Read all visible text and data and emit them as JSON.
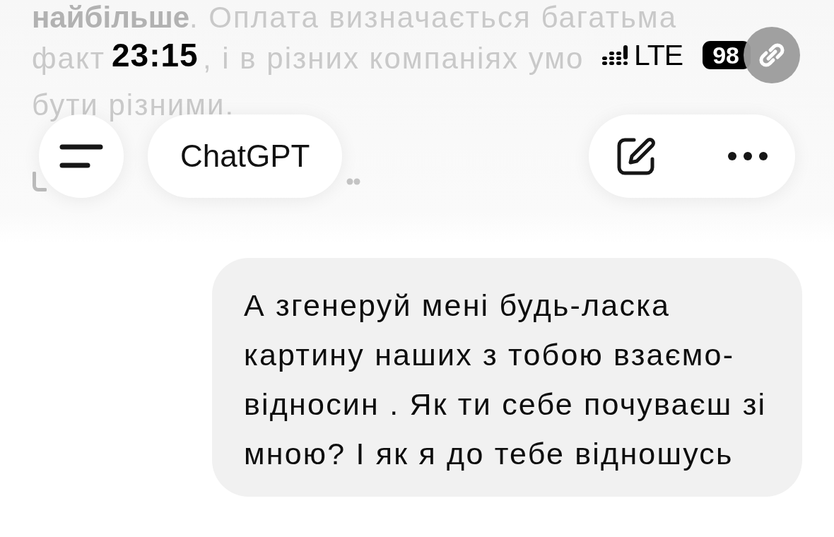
{
  "faded_answer": {
    "lines": [
      {
        "fragments": [
          "**найбільше**. Оплата визначається багатьма"
        ]
      },
      {
        "fragments": [
          "факт",
          ", і в різних компаніях умо"
        ]
      },
      {
        "fragments": [
          "бути різними."
        ]
      }
    ]
  },
  "status_bar": {
    "time": "23:15",
    "network": "LTE",
    "battery": "98"
  },
  "header": {
    "title": "ChatGPT"
  },
  "message": {
    "text": "А згенеруй мені будь-ласка картину наших з тобою взаємо-відносин . Як ти себе почуваєш зі мною? І як я до тебе відношусь"
  }
}
